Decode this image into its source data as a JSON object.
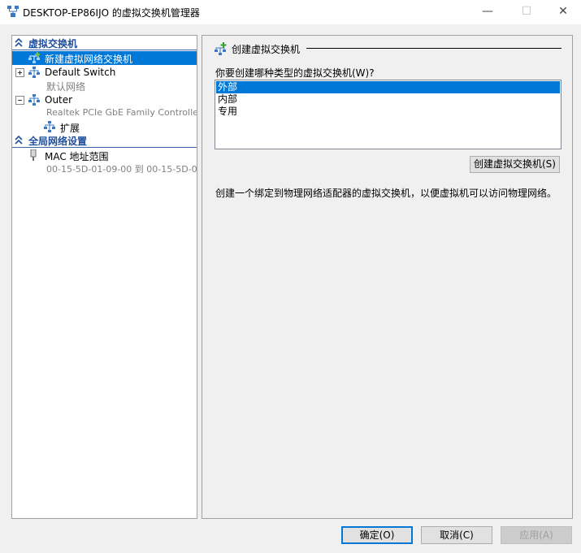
{
  "window": {
    "title": "DESKTOP-EP86IJO 的虚拟交换机管理器",
    "minimize": "—",
    "maximize": "☐",
    "close": "✕"
  },
  "sidebar": {
    "virtual_switches_header": "虚拟交换机",
    "new_switch": "新建虚拟网络交换机",
    "default_switch": {
      "label": "Default Switch",
      "sub": "默认网络"
    },
    "outer_switch": {
      "label": "Outer",
      "sub": "Realtek PCIe GbE Family Controller"
    },
    "extensions": "扩展",
    "global_header": "全局网络设置",
    "mac_range": {
      "label": "MAC 地址范围",
      "sub": "00-15-5D-01-09-00 到 00-15-5D-0..."
    }
  },
  "main": {
    "group_title": "创建虚拟交换机",
    "prompt": "你要创建哪种类型的虚拟交换机(W)?",
    "switch_types": [
      "外部",
      "内部",
      "专用"
    ],
    "selected_type": "外部",
    "create_button": "创建虚拟交换机(S)",
    "description": "创建一个绑定到物理网络适配器的虚拟交换机，以便虚拟机可以访问物理网络。"
  },
  "footer": {
    "ok": "确定(O)",
    "cancel": "取消(C)",
    "apply": "应用(A)"
  },
  "colors": {
    "selection": "#0078d7",
    "section_header": "#1f4e9c",
    "window_bg": "#f0f0f0"
  }
}
